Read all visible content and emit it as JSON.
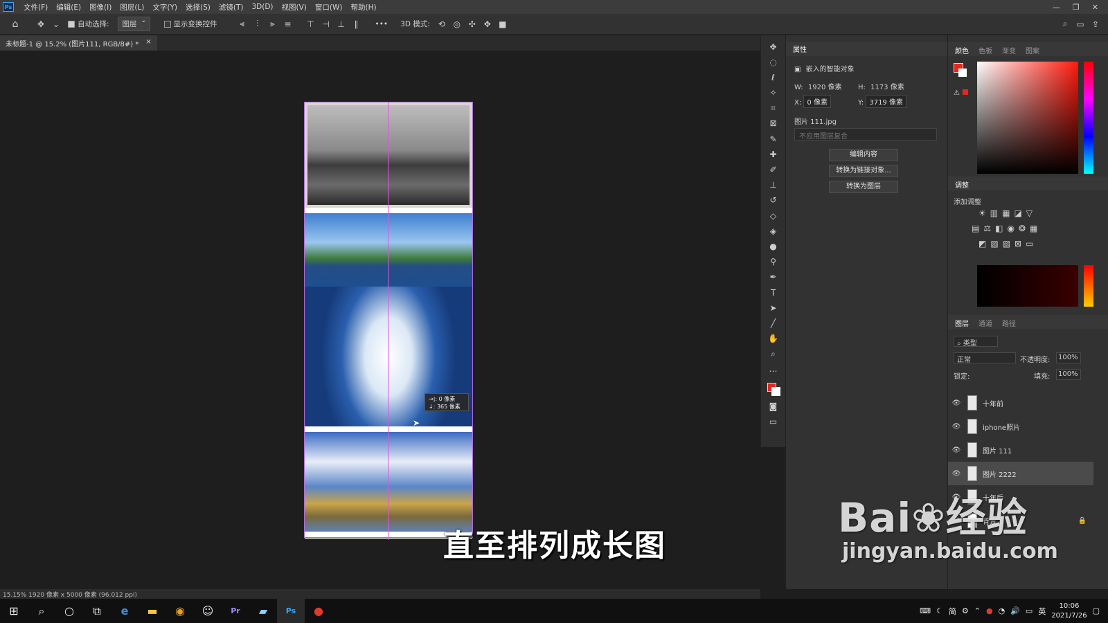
{
  "menu": {
    "items": [
      "文件(F)",
      "编辑(E)",
      "图像(I)",
      "图层(L)",
      "文字(Y)",
      "选择(S)",
      "滤镜(T)",
      "3D(D)",
      "视图(V)",
      "窗口(W)",
      "帮助(H)"
    ],
    "window_controls": [
      "—",
      "❐",
      "✕"
    ]
  },
  "options": {
    "auto_select_label": "自动选择:",
    "auto_select_value": "图层",
    "show_transform_label": "显示变换控件",
    "mode_3d_label": "3D 模式:",
    "more": "•••"
  },
  "document": {
    "tab_title": "未标题-1 @ 15.2% (图片111, RGB/8#) *",
    "close": "×"
  },
  "canvas": {
    "tooltip_line1": "→|: 0 像素",
    "tooltip_line2": "↓: 365 像素",
    "subtitle": "直至排列成长图"
  },
  "status": {
    "text": "15.15%  1920 像素 x 5000 像素 (96.012 ppi)"
  },
  "properties": {
    "tab": "属性",
    "type": "嵌入的智能对象",
    "w_label": "W:",
    "w_value": "1920 像素",
    "h_label": "H:",
    "h_value": "1173 像素",
    "x_label": "X:",
    "x_value": "0 像素",
    "y_label": "Y:",
    "y_value": "3719 像素",
    "filename": "图片 111.jpg",
    "comp_placeholder": "不应用图层复合",
    "btn_edit": "编辑内容",
    "btn_link": "转换为链接对象...",
    "btn_layer": "转换为图层"
  },
  "color_panel": {
    "tabs": [
      "颜色",
      "色板",
      "渐变",
      "图案"
    ],
    "fg_color": "#e8261d",
    "bg_color": "#ffffff"
  },
  "adjust_panel": {
    "tab": "调整",
    "label": "添加调整"
  },
  "layers_panel": {
    "tabs": [
      "图层",
      "通道",
      "路径"
    ],
    "filter": "类型",
    "blend": "正常",
    "opacity_label": "不透明度:",
    "opacity_value": "100%",
    "lock_label": "锁定:",
    "fill_label": "填充:",
    "fill_value": "100%",
    "layers": [
      "十年前",
      "iphone照片",
      "图片 111",
      "图片 2222",
      "十年后",
      "背景"
    ]
  },
  "watermark": {
    "line1": "Bai❀经验",
    "line2": "jingyan.baidu.com"
  },
  "taskbar": {
    "tray_text": "简",
    "time": "10:06",
    "date": "2021/7/26",
    "lang": "英"
  }
}
